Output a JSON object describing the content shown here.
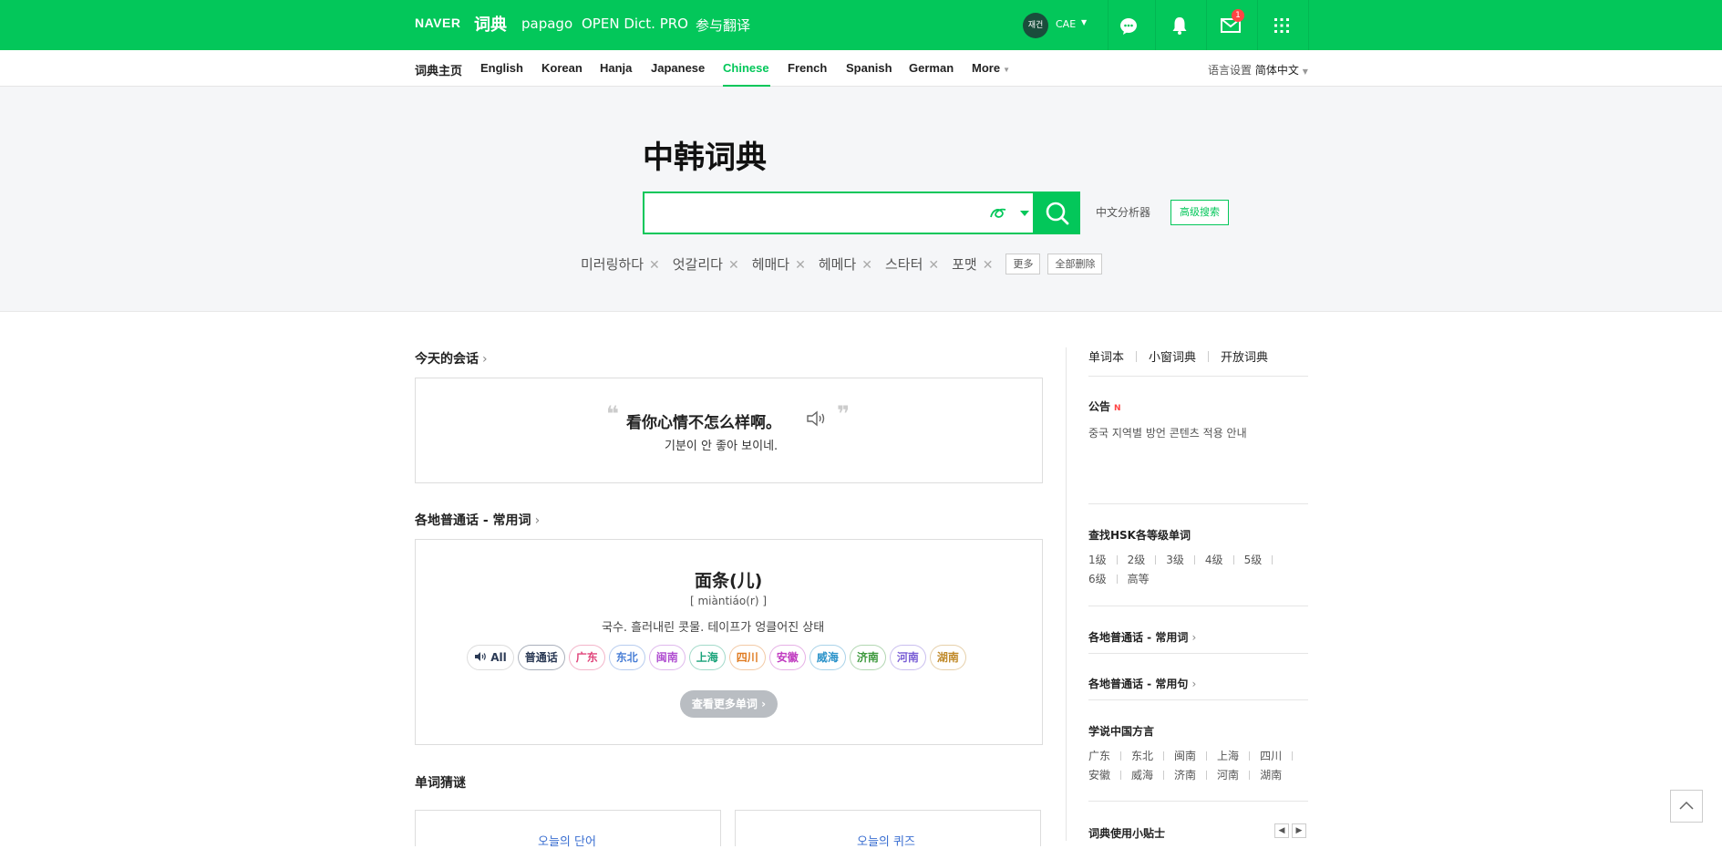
{
  "header": {
    "brand": "NAVER",
    "dict": "词典",
    "links": [
      "papago",
      "OPEN Dict. PRO",
      "参与翻译"
    ],
    "avatar_text": "재건",
    "user": "CAE",
    "mail_badge": "1"
  },
  "nav": {
    "items": [
      "词典主页",
      "English",
      "Korean",
      "Hanja",
      "Japanese",
      "Chinese",
      "French",
      "Spanish",
      "German",
      "More"
    ],
    "active": "Chinese",
    "lang_label": "语言设置",
    "lang_value": "简体中文"
  },
  "search": {
    "title": "中韩词典",
    "placeholder": "",
    "analyzer": "中文分析器",
    "advanced": "高级搜索",
    "recent": [
      "미러링하다",
      "엇갈리다",
      "헤매다",
      "헤메다",
      "스타터",
      "포맷"
    ],
    "more": "更多",
    "delete_all": "全部删除"
  },
  "conversation": {
    "title": "今天的会话",
    "zh": "看你心情不怎么样啊。",
    "ko": "기분이 안 좋아 보이네."
  },
  "dialect": {
    "title": "各地普通话 - 常用词",
    "word": "面条(儿)",
    "pinyin": "[ miàntiáo(r) ]",
    "meaning": "국수. 흘러내린 콧물. 테이프가 엉클어진 상태",
    "all_label": "All",
    "regions": [
      {
        "name": "普通话",
        "color": "#2b3a55"
      },
      {
        "name": "广东",
        "color": "#e0457b"
      },
      {
        "name": "东北",
        "color": "#4a7fd6"
      },
      {
        "name": "闽南",
        "color": "#b04fd1"
      },
      {
        "name": "上海",
        "color": "#1aa37a"
      },
      {
        "name": "四川",
        "color": "#e07b21"
      },
      {
        "name": "安徽",
        "color": "#c03bc0"
      },
      {
        "name": "威海",
        "color": "#2a92c9"
      },
      {
        "name": "济南",
        "color": "#3f9a3f"
      },
      {
        "name": "河南",
        "color": "#7a5fd6"
      },
      {
        "name": "湖南",
        "color": "#c08a2a"
      }
    ],
    "more_words": "查看更多单词"
  },
  "quiz": {
    "title": "单词猜谜",
    "cards": [
      "오늘의 단어",
      "오늘의 퀴즈"
    ]
  },
  "sidebar": {
    "tabs": [
      "单词本",
      "小窗词典",
      "开放词典"
    ],
    "notice_title": "公告",
    "notice_new": "N",
    "notice_text": "중국 지역별 방언 콘텐츠 적용 안내",
    "hsk_title": "查找HSK各等级单词",
    "hsk_row1": [
      "1级",
      "2级",
      "3级",
      "4级",
      "5级"
    ],
    "hsk_row2": [
      "6级",
      "高等"
    ],
    "words_link": "各地普通话 - 常用词",
    "sentences_link": "各地普通话 - 常用句",
    "dialect_title": "学说中国方言",
    "dialect_row1": [
      "广东",
      "东北",
      "闽南",
      "上海",
      "四川"
    ],
    "dialect_row2": [
      "安徽",
      "威海",
      "济南",
      "河南",
      "湖南"
    ],
    "tips_title": "词典使用小贴士"
  }
}
